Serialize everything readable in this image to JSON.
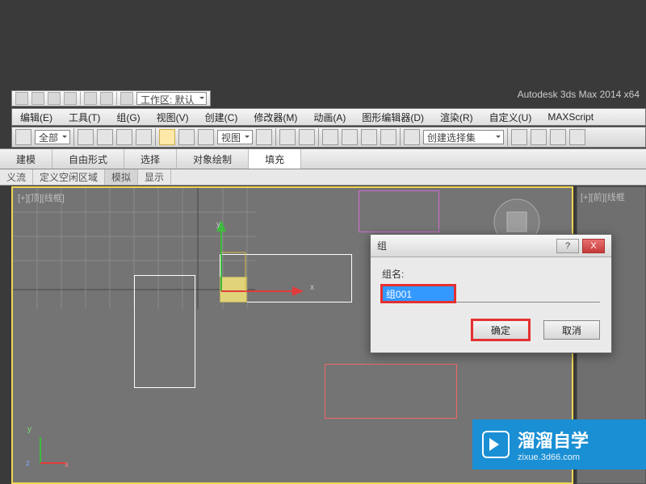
{
  "app_title": "Autodesk 3ds Max  2014 x64",
  "workspace_label": "工作区: 默认",
  "menus": [
    "编辑(E)",
    "工具(T)",
    "组(G)",
    "视图(V)",
    "创建(C)",
    "修改器(M)",
    "动画(A)",
    "图形编辑器(D)",
    "渲染(R)",
    "自定义(U)",
    "MAXScript"
  ],
  "toolbar": {
    "filter": "全部",
    "view_label": "视图",
    "named_sel": "创建选择集"
  },
  "ribbon_tabs": {
    "items": [
      "建模",
      "自由形式",
      "选择",
      "对象绘制",
      "填充"
    ],
    "active": "填充"
  },
  "subtabs": {
    "items": [
      "义流",
      "定义空闲区域",
      "模拟",
      "显示"
    ],
    "active": "模拟"
  },
  "viewport": {
    "label": "[+][顶][线框]",
    "axes": {
      "x": "x",
      "y": "y",
      "z": "z"
    }
  },
  "viewport_right_label": "[+][前][线框",
  "dialog": {
    "title": "组",
    "label": "组名:",
    "value": "组001",
    "ok": "确定",
    "cancel": "取消",
    "help": "?",
    "close": "X"
  },
  "watermark": {
    "brand": "溜溜自学",
    "url": "zixue.3d66.com"
  }
}
